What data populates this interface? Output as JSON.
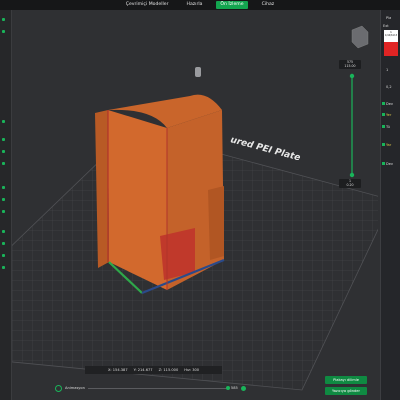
{
  "tabs": [
    {
      "label": "Çevrimiçi Modeller"
    },
    {
      "label": "Hazırla"
    },
    {
      "label": "Ön İzleme"
    },
    {
      "label": "Cihaz"
    }
  ],
  "active_tab": 2,
  "plate_label": "ured PEI Plate",
  "layer_slider": {
    "top_value": "575",
    "top_height": "115.00",
    "bottom_value": "1",
    "bottom_height": "0.20"
  },
  "coords": {
    "x": "X: 154.387",
    "y": "Y: 214.677",
    "z": "Z: 115.000",
    "hiz": "Hız: 300"
  },
  "bottom_bar": {
    "label": "Animasyon",
    "right_value": "585"
  },
  "buttons": {
    "export": "Plakayı dilimle",
    "send": "Yazıcıya gönder"
  },
  "right_panel": {
    "lines": [
      {
        "text": "Pla"
      },
      {
        "text": "1"
      },
      {
        "text": "0,2"
      },
      {
        "text": "Dev"
      },
      {
        "text": "Yer"
      },
      {
        "text": "Tü"
      },
      {
        "text": "Yar"
      },
      {
        "text": "Dev"
      }
    ],
    "fields": [
      "1",
      "1/44/6113",
      "0,2",
      "Ext"
    ]
  },
  "colors": {
    "accent": "#13a54f",
    "model": "#d2692d",
    "plate": "#3a3b3e"
  }
}
